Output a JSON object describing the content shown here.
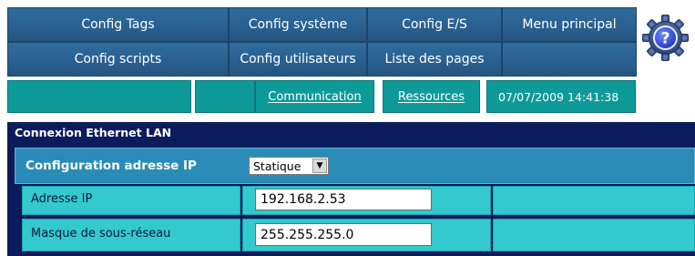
{
  "nav": {
    "row1": [
      "Config Tags",
      "Config système",
      "Config E/S",
      "Menu principal"
    ],
    "row2": [
      "Config scripts",
      "Config utilisateurs",
      "Liste des pages",
      ""
    ],
    "help_icon": "help-question-icon"
  },
  "subnav": {
    "communication": "Communication",
    "ressources": "Ressources",
    "datetime": "07/07/2009 14:41:38"
  },
  "panel": {
    "title": "Connexion Ethernet LAN",
    "config_label": "Configuration adresse IP",
    "config_value": "Statique",
    "ip_label": "Adresse IP",
    "ip_value": "192.168.2.53",
    "mask_label": "Masque de sous-réseau",
    "mask_value": "255.255.255.0"
  },
  "colors": {
    "nav_blue": "#2a6091",
    "teal": "#0f9a9a",
    "panel_navy": "#0b1b5c",
    "row_blue": "#2a8cb6",
    "cell_cyan": "#33c9cf"
  }
}
